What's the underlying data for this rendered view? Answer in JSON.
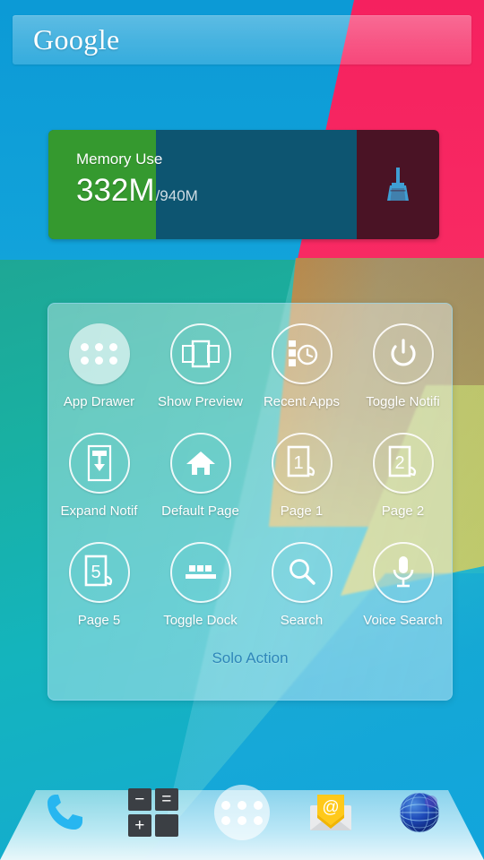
{
  "search": {
    "wordmark": "Google"
  },
  "memory_widget": {
    "title": "Memory Use",
    "used": "332M",
    "total": "/940M",
    "used_mb": 332,
    "total_mb": 940,
    "percent": 35,
    "clean_icon": "broom-icon",
    "bar_color": "#35992f",
    "track_color": "#0d5571",
    "clean_bg_color": "#4a1325",
    "broom_color": "#3f9fd4"
  },
  "action_panel": {
    "footer_label": "Solo Action",
    "items": [
      {
        "label": "App Drawer",
        "icon": "app-drawer-icon",
        "filled": true
      },
      {
        "label": "Show Preview",
        "icon": "show-preview-icon",
        "filled": false
      },
      {
        "label": "Recent Apps",
        "icon": "recent-apps-icon",
        "filled": false
      },
      {
        "label": "Toggle Notifi",
        "icon": "power-toggle-icon",
        "filled": false
      },
      {
        "label": "Expand Notif",
        "icon": "expand-notification-icon",
        "filled": false
      },
      {
        "label": "Default Page",
        "icon": "home-icon",
        "filled": false
      },
      {
        "label": "Page 1",
        "icon": "page-1-icon",
        "filled": false
      },
      {
        "label": "Page 2",
        "icon": "page-2-icon",
        "filled": false
      },
      {
        "label": "Page 5",
        "icon": "page-5-icon",
        "filled": false
      },
      {
        "label": "Toggle Dock",
        "icon": "toggle-dock-icon",
        "filled": false
      },
      {
        "label": "Search",
        "icon": "search-icon",
        "filled": false
      },
      {
        "label": "Voice Search",
        "icon": "microphone-icon",
        "filled": false
      }
    ]
  },
  "dock": {
    "items": [
      {
        "name": "phone",
        "icon": "phone-icon"
      },
      {
        "name": "calculator",
        "icon": "calculator-icon",
        "keys": [
          "−",
          "=",
          "+",
          ""
        ]
      },
      {
        "name": "app-drawer",
        "icon": "app-drawer-icon"
      },
      {
        "name": "email",
        "icon": "email-icon"
      },
      {
        "name": "browser",
        "icon": "browser-globe-icon"
      }
    ]
  },
  "wallpaper": {
    "colors": {
      "blue": "#0f9fd8",
      "pink": "#f6245f",
      "teal": "#19ab9c",
      "brown": "#bd8430",
      "yellow": "#dcc73f",
      "cyan": "#12a5dc"
    }
  }
}
